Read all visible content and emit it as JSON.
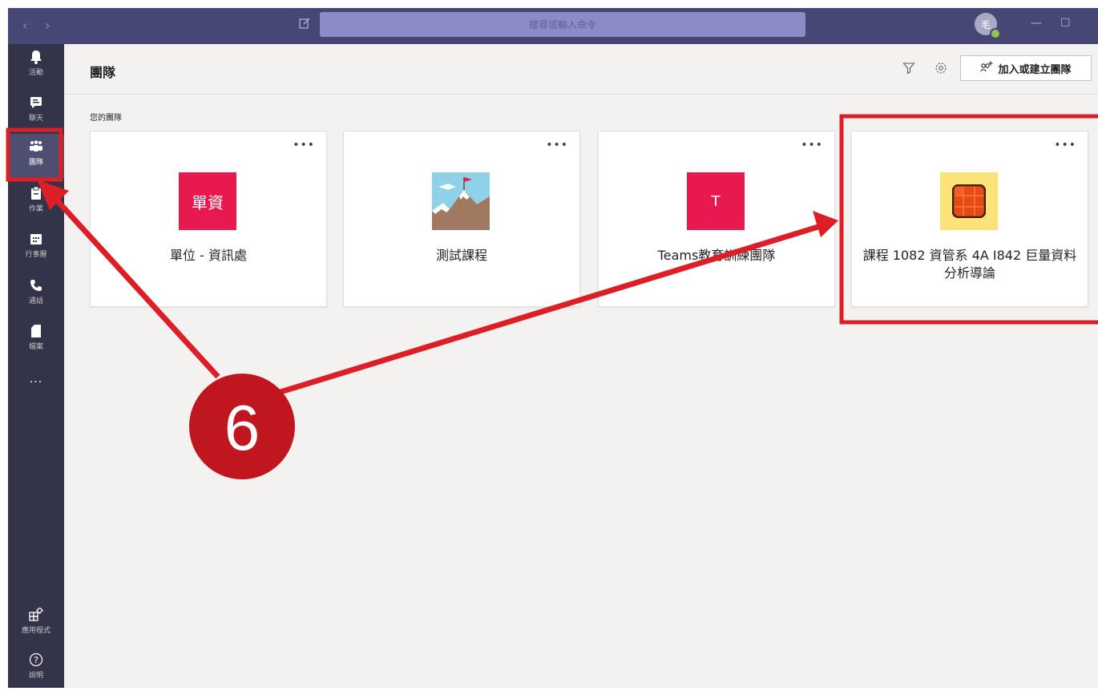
{
  "topbar": {
    "search_placeholder": "搜尋或輸入命令",
    "avatar_initial": "毛"
  },
  "rail": {
    "items": [
      {
        "label": "活動",
        "icon": "bell-icon"
      },
      {
        "label": "聊天",
        "icon": "chat-icon"
      },
      {
        "label": "團隊",
        "icon": "teams-icon",
        "active": true
      },
      {
        "label": "作業",
        "icon": "assignments-icon"
      },
      {
        "label": "行事曆",
        "icon": "calendar-icon"
      },
      {
        "label": "通話",
        "icon": "phone-icon"
      },
      {
        "label": "檔案",
        "icon": "files-icon"
      },
      {
        "label": "...",
        "icon": "more-icon"
      }
    ],
    "bottom": [
      {
        "label": "應用程式",
        "icon": "apps-icon"
      },
      {
        "label": "說明",
        "icon": "help-icon"
      }
    ]
  },
  "header": {
    "title": "團隊",
    "join_button": "加入或建立團隊"
  },
  "section_label": "您的團隊",
  "teams": [
    {
      "name": "單位 - 資訊處",
      "tile_text": "單資",
      "tile_color": "#e8194e"
    },
    {
      "name": "測試課程",
      "tile_text": "",
      "tile_color": "#8fd1e8"
    },
    {
      "name": "Teams教育訓練團隊",
      "tile_text": "T",
      "tile_color": "#e8194e"
    },
    {
      "name": "課程 1082 資管系 4A I842 巨量資料分析導論",
      "tile_text": "",
      "tile_color": "#fde27a"
    }
  ],
  "annotation": {
    "number": "6",
    "color": "#c0161f"
  }
}
